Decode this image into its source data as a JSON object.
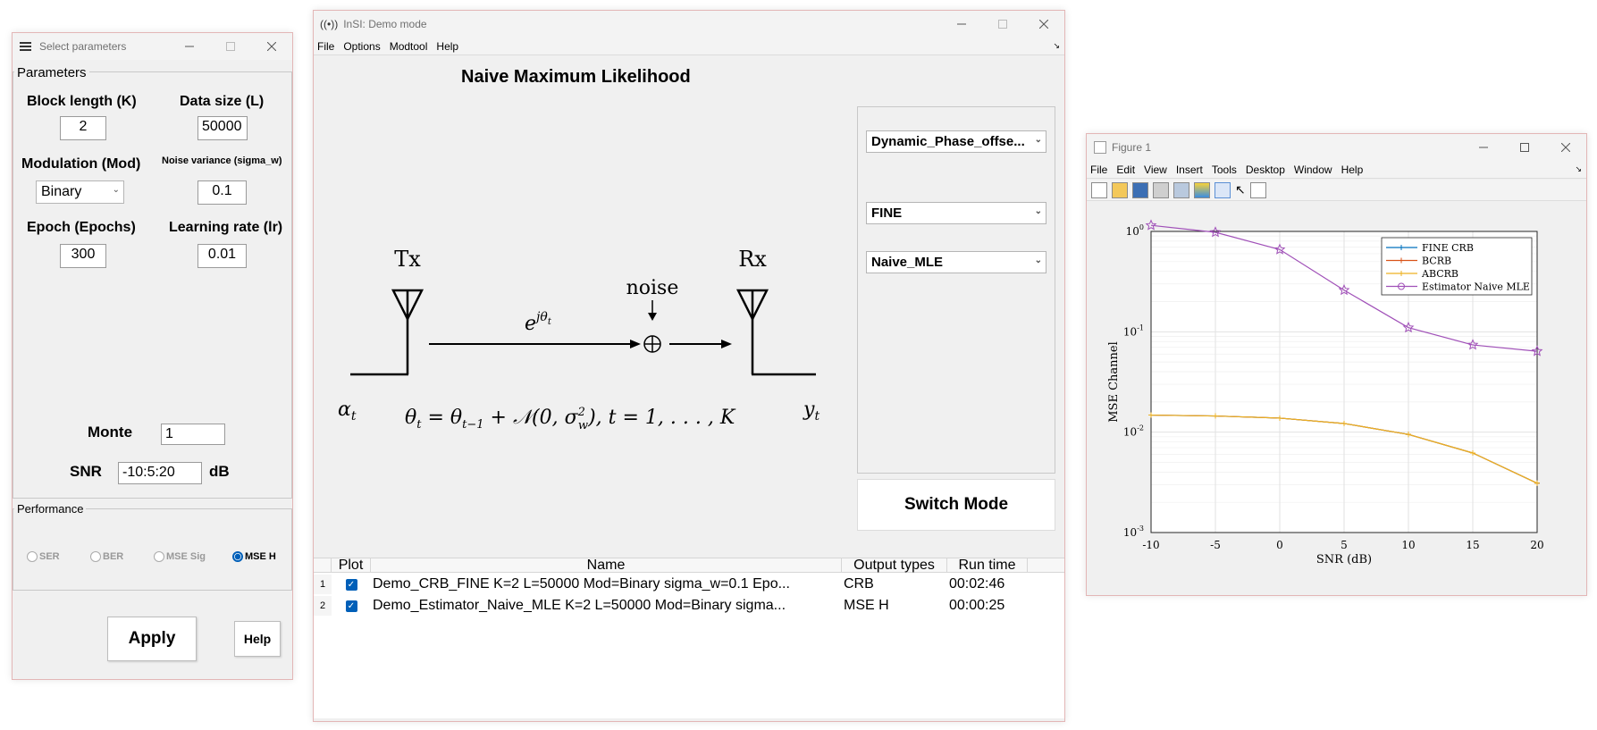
{
  "select_window": {
    "title": "Select parameters",
    "group_parameters": "Parameters",
    "block_length_label": "Block length (K)",
    "block_length_value": "2",
    "data_size_label": "Data size (L)",
    "data_size_value": "50000",
    "modulation_label": "Modulation (Mod)",
    "modulation_value": "Binary",
    "noise_label": "Noise variance (sigma_w)",
    "noise_value": "0.1",
    "epoch_label": "Epoch (Epochs)",
    "epoch_value": "300",
    "lr_label": "Learning rate (lr)",
    "lr_value": "0.01",
    "monte_label": "Monte",
    "monte_value": "1",
    "snr_label": "SNR",
    "snr_value": "-10:5:20",
    "snr_unit": "dB",
    "group_performance": "Performance",
    "radios": [
      {
        "label": "SER",
        "selected": false
      },
      {
        "label": "BER",
        "selected": false
      },
      {
        "label": "MSE Sig",
        "selected": false
      },
      {
        "label": "MSE H",
        "selected": true
      }
    ],
    "apply_label": "Apply",
    "help_label": "Help"
  },
  "insi_window": {
    "title": "InSI: Demo mode",
    "menu": [
      "File",
      "Options",
      "Modtool",
      "Help"
    ],
    "heading": "Naive Maximum Likelihood",
    "diagram": {
      "tx": "Tx",
      "rx": "Rx",
      "noise": "noise",
      "channel": "e^{jθ_t}",
      "alpha": "α_t",
      "y": "y_t",
      "equation": "θ_t = θ_{t−1} + N(0, σ_w^2), t = 1, . . . , K"
    },
    "dropdown_model": "Dynamic_Phase_offse...",
    "dropdown_bound": "FINE",
    "dropdown_estimator": "Naive_MLE",
    "switch_mode_label": "Switch Mode",
    "table": {
      "headers": [
        "Plot",
        "Name",
        "Output types",
        "Run time"
      ],
      "rows": [
        {
          "index": "1",
          "name": "Demo_CRB_FINE K=2 L=50000 Mod=Binary sigma_w=0.1 Epo...",
          "output": "CRB",
          "time": "00:02:46",
          "checked": true
        },
        {
          "index": "2",
          "name": "Demo_Estimator_Naive_MLE K=2 L=50000 Mod=Binary sigma...",
          "output": "MSE H",
          "time": "00:00:25",
          "checked": true
        }
      ]
    }
  },
  "figure_window": {
    "title": "Figure 1",
    "menu": [
      "File",
      "Edit",
      "View",
      "Insert",
      "Tools",
      "Desktop",
      "Window",
      "Help"
    ]
  },
  "chart_data": {
    "type": "line",
    "x": [
      -10,
      -5,
      0,
      5,
      10,
      15,
      20
    ],
    "xlabel": "SNR (dB)",
    "ylabel": "MSE Channel",
    "xlim": [
      -10,
      20
    ],
    "ylim": [
      0.001,
      1
    ],
    "yscale": "log",
    "xticks": [
      "-10",
      "-5",
      "0",
      "5",
      "10",
      "15",
      "20"
    ],
    "yticks": [
      {
        "base": "10",
        "exp": "0",
        "value": 1
      },
      {
        "base": "10",
        "exp": "-1",
        "value": 0.1
      },
      {
        "base": "10",
        "exp": "-2",
        "value": 0.01
      },
      {
        "base": "10",
        "exp": "-3",
        "value": 0.001
      }
    ],
    "grid": true,
    "legend_position": "top-right",
    "series": [
      {
        "name": "FINE CRB",
        "color": "#0072bd",
        "marker": "plus",
        "values": [
          0.0148,
          0.0145,
          0.0138,
          0.0122,
          0.0095,
          0.0062,
          0.0031
        ]
      },
      {
        "name": "BCRB",
        "color": "#d95319",
        "marker": "plus",
        "values": [
          0.0148,
          0.0145,
          0.0138,
          0.0122,
          0.0095,
          0.0062,
          0.0031
        ]
      },
      {
        "name": "ABCRB",
        "color": "#edb120",
        "marker": "plus",
        "values": [
          0.0148,
          0.0145,
          0.0138,
          0.0122,
          0.0095,
          0.0062,
          0.0031
        ]
      },
      {
        "name": "Estimator Naive MLE",
        "color": "#a050b8",
        "marker": "star",
        "values": [
          1.15,
          0.98,
          0.66,
          0.26,
          0.11,
          0.074,
          0.064
        ]
      }
    ]
  }
}
